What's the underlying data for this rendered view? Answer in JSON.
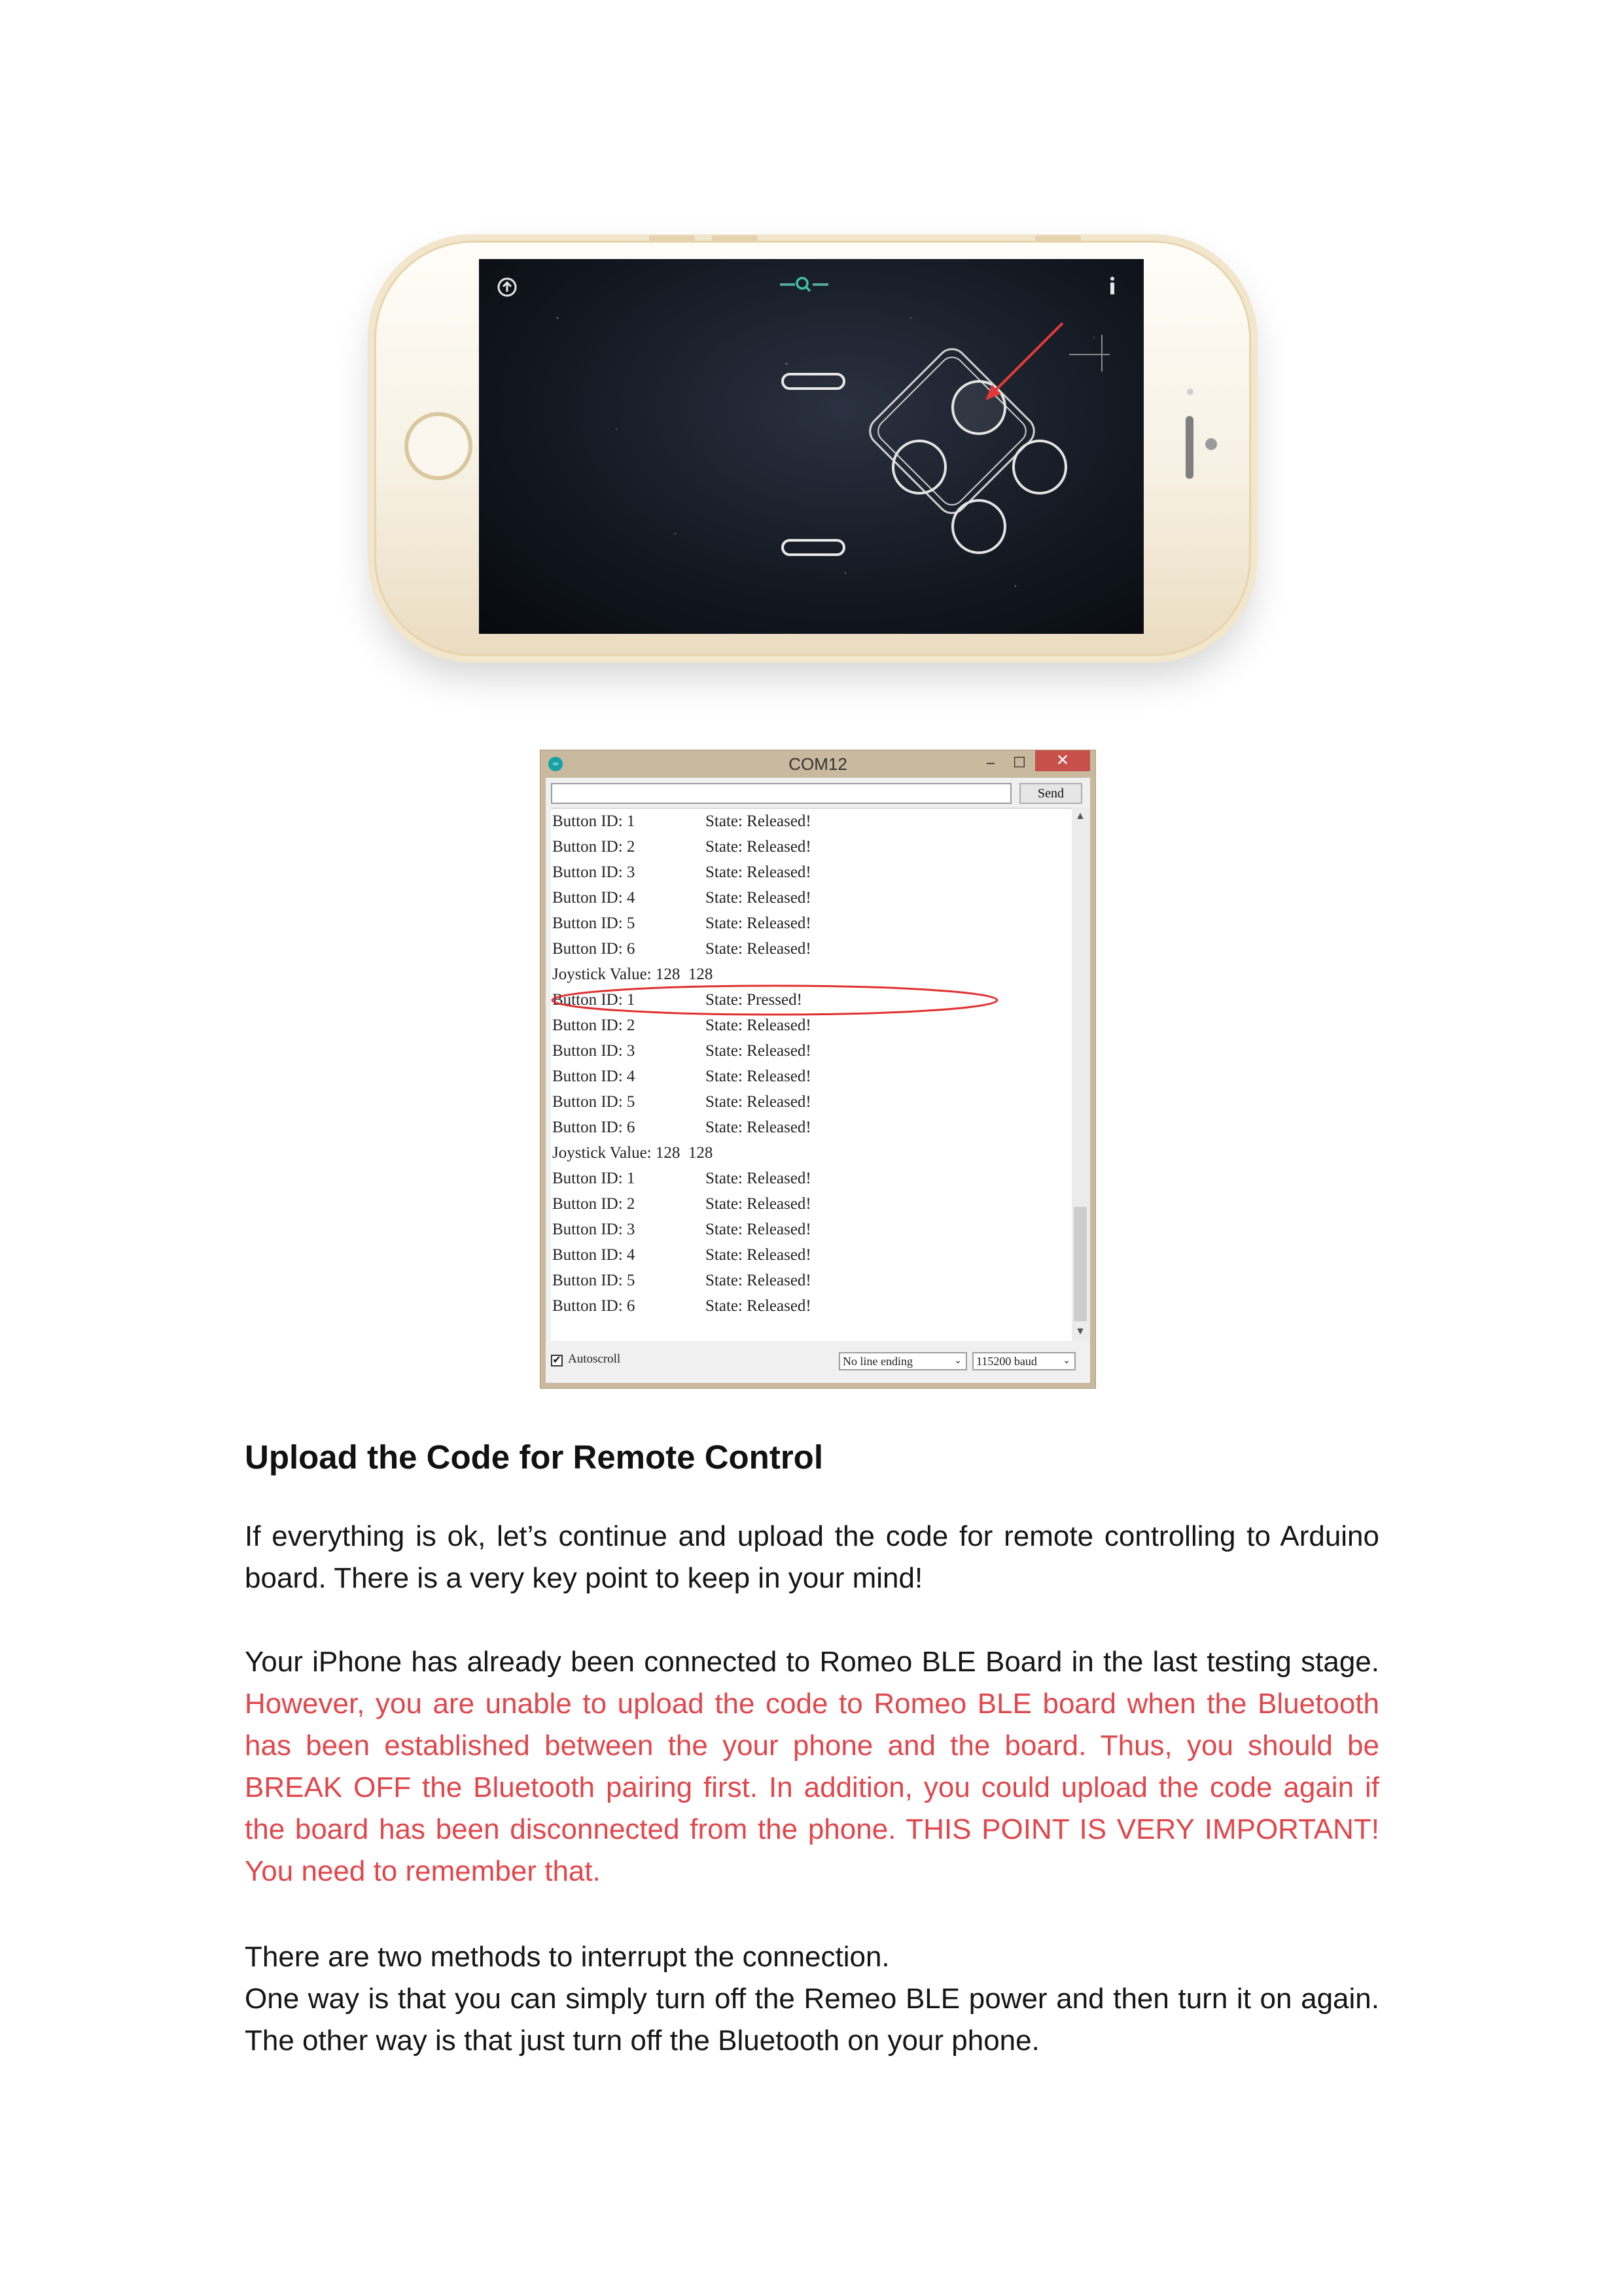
{
  "phone_screenshot": {
    "app_screen": {
      "top_left_icon": "arrow-up-circle-icon",
      "top_center_icon": "search-icon",
      "top_right_icon": "info-icon",
      "crosshair_icon": "crosshair-icon",
      "action_buttons": [
        "pill-button-top",
        "pill-button-bottom"
      ],
      "dpad_buttons": [
        "button-up",
        "button-left",
        "button-right",
        "button-down"
      ],
      "annotation_arrow_color": "#e23a3a"
    }
  },
  "serial_monitor": {
    "title": "COM12",
    "min_label": "–",
    "max_label": "☐",
    "close_label": "✕",
    "send_label": "Send",
    "lines": [
      {
        "a": "Button ID: 1",
        "b": "State: Released!"
      },
      {
        "a": "Button ID: 2",
        "b": "State: Released!"
      },
      {
        "a": "Button ID: 3",
        "b": "State: Released!"
      },
      {
        "a": "Button ID: 4",
        "b": "State: Released!"
      },
      {
        "a": "Button ID: 5",
        "b": "State: Released!"
      },
      {
        "a": "Button ID: 6",
        "b": "State: Released!"
      },
      {
        "a": "Joystick Value: 128  128",
        "b": ""
      },
      {
        "a": "Button ID: 1",
        "b": "State: Pressed!"
      },
      {
        "a": "Button ID: 2",
        "b": "State: Released!"
      },
      {
        "a": "Button ID: 3",
        "b": "State: Released!"
      },
      {
        "a": "Button ID: 4",
        "b": "State: Released!"
      },
      {
        "a": "Button ID: 5",
        "b": "State: Released!"
      },
      {
        "a": "Button ID: 6",
        "b": "State: Released!"
      },
      {
        "a": "Joystick Value: 128  128",
        "b": ""
      },
      {
        "a": "Button ID: 1",
        "b": "State: Released!"
      },
      {
        "a": "Button ID: 2",
        "b": "State: Released!"
      },
      {
        "a": "Button ID: 3",
        "b": "State: Released!"
      },
      {
        "a": "Button ID: 4",
        "b": "State: Released!"
      },
      {
        "a": "Button ID: 5",
        "b": "State: Released!"
      },
      {
        "a": "Button ID: 6",
        "b": "State: Released!"
      }
    ],
    "highlighted_line": 7,
    "highlight_color": "#e03030",
    "autoscroll_label": "Autoscroll",
    "autoscroll_checked": true,
    "line_ending": "No line ending",
    "baud_rate": "115200 baud"
  },
  "document": {
    "heading": "Upload the Code for Remote Control",
    "para1": "If everything is ok, let’s continue and upload the code for remote controlling to Arduino board. There is a very key point to keep in your mind!",
    "para2_intro": "Your iPhone has already been connected to Romeo BLE Board in the last testing stage.",
    "para2_warning": "However, you are unable to upload the code to Romeo BLE board when the Bluetooth has been established between the your phone and the board. Thus, you should be BREAK OFF the Bluetooth pairing first. In addition, you could upload the code again if the board has been disconnected from the phone. THIS POINT IS VERY IMPORTANT! You need to remember that.",
    "para3_line1": "There are two methods to interrupt the connection.",
    "para3_line2": "One way is that you can simply turn off the Remeo BLE power and then turn it on again. The other way is that just turn off the Bluetooth on your phone.",
    "warning_color": "#e0474c"
  }
}
